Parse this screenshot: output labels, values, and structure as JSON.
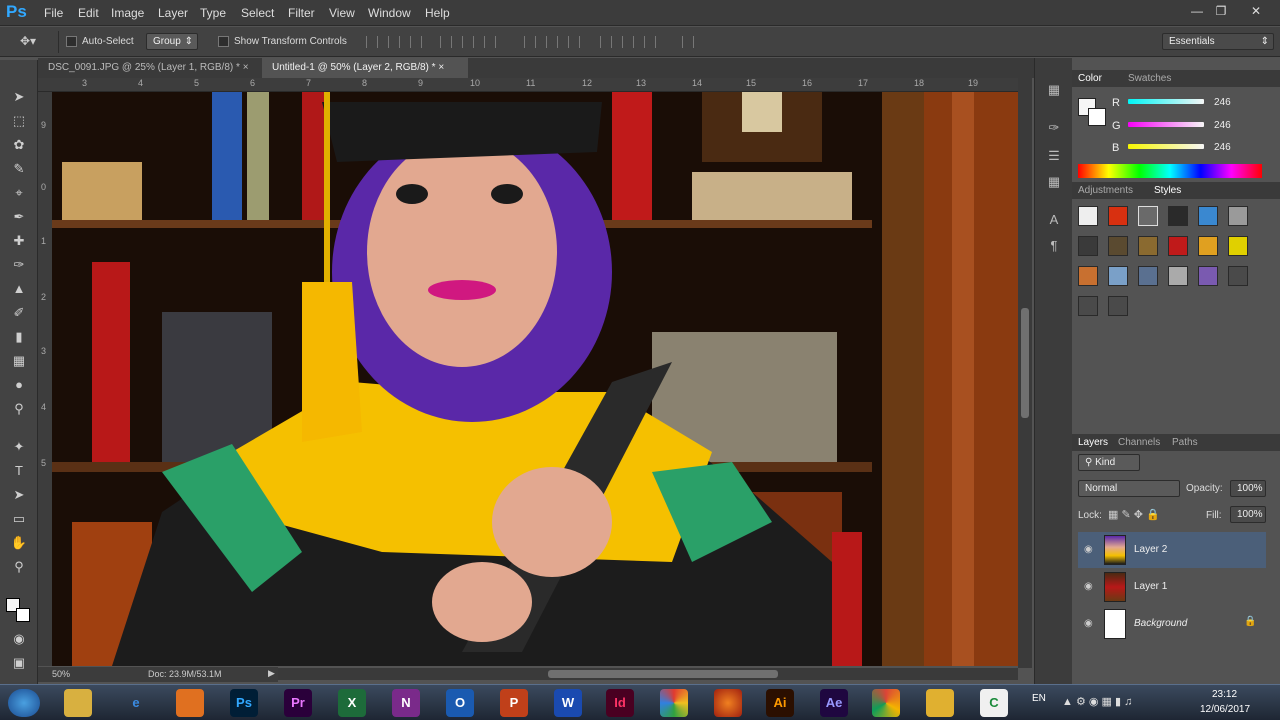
{
  "app": {
    "logo": "Ps"
  },
  "menu": [
    "File",
    "Edit",
    "Image",
    "Layer",
    "Type",
    "Select",
    "Filter",
    "View",
    "Window",
    "Help"
  ],
  "window_controls": [
    "min-icon",
    "restore-icon",
    "close-icon"
  ],
  "options": {
    "auto_select": "Auto-Select",
    "group": "Group",
    "show_transform": "Show Transform Controls",
    "workspace": "Essentials"
  },
  "tabs": [
    {
      "label": "DSC_0091.JPG @ 25% (Layer 1, RGB/8) *",
      "close": "×"
    },
    {
      "label": "Untitled-1 @ 50% (Layer 2, RGB/8) *",
      "close": "×"
    }
  ],
  "ruler": {
    "h": [
      "3",
      "4",
      "5",
      "6",
      "7",
      "8",
      "9",
      "10",
      "11",
      "12",
      "13",
      "14",
      "15",
      "16",
      "17",
      "18",
      "19"
    ],
    "v": [
      "9",
      "0",
      "1",
      "2",
      "3",
      "4",
      "5"
    ]
  },
  "status": {
    "zoom": "50%",
    "doc": "Doc: 23.9M/53.1M"
  },
  "color_panel": {
    "tabs": [
      "Color",
      "Swatches"
    ],
    "r_label": "R",
    "g_label": "G",
    "b_label": "B",
    "r": "246",
    "g": "246",
    "b": "246"
  },
  "styles_panel": {
    "tabs": [
      "Adjustments",
      "Styles"
    ]
  },
  "layers_panel": {
    "tabs": [
      "Layers",
      "Channels",
      "Paths"
    ],
    "kind": "Kind",
    "blend": "Normal",
    "opacity_label": "Opacity:",
    "opacity": "100%",
    "lock_label": "Lock:",
    "fill_label": "Fill:",
    "fill": "100%",
    "layers": [
      {
        "name": "Layer 2"
      },
      {
        "name": "Layer 1"
      },
      {
        "name": "Background"
      }
    ]
  },
  "taskbar": {
    "apps": [
      "Pr",
      "Ps",
      "Ai",
      "Ae"
    ],
    "lang": "EN",
    "time": "23:12",
    "date": "12/06/2017"
  },
  "colors": {
    "bg": "#535353",
    "dark": "#3c3c3c",
    "accent": "#31a8ff",
    "selected_layer": "#4b5f79"
  }
}
